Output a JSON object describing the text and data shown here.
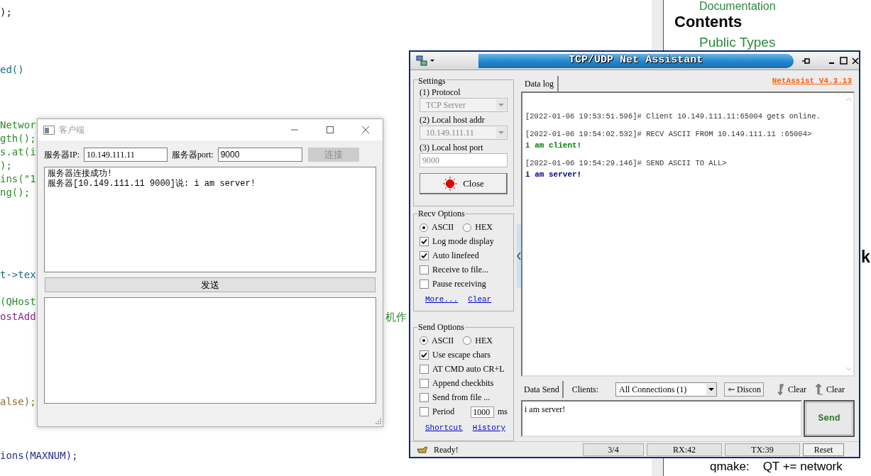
{
  "code_editor": {
    "lines": [
      {
        "text": ");",
        "kind": "plain"
      },
      {
        "text": "ed()",
        "kind": "method"
      },
      {
        "text": "Networ",
        "kind": "type"
      },
      {
        "text": "gth();",
        "kind": "type"
      },
      {
        "text": "s.at(i",
        "kind": "type"
      },
      {
        "text": ");",
        "kind": "type"
      },
      {
        "text": "ins(\"1",
        "kind": "type"
      },
      {
        "text": "ng();",
        "kind": "type"
      },
      {
        "text": "t->tex",
        "kind": "method"
      },
      {
        "text": "(QHost",
        "kind": "type"
      },
      {
        "text": "ostAdd",
        "kind": "member"
      },
      {
        "text": "alse);",
        "kind": "keyword"
      },
      {
        "text": "ions(MAXNUM);",
        "kind": "macro"
      }
    ],
    "comment_fragment": "机作"
  },
  "docs": {
    "link_top": "Documentation",
    "heading": "Contents",
    "link": "Public Types",
    "heading_fragment": "k",
    "note": "qmake:    QT += network"
  },
  "client_window": {
    "title": "客户端",
    "ip_label": "服务器IP:",
    "ip_value": "10.149.111.11",
    "port_label": "服务器port:",
    "port_value": "9000",
    "connect_button": {
      "label": "连接",
      "disabled": true
    },
    "log_lines": [
      "服务器连接成功!",
      "服务器[10.149.111.11 9000]说: i am server!"
    ],
    "send_button": "发送"
  },
  "net_assist": {
    "title": "TCP/UDP Net Assistant",
    "settings": {
      "title": "Settings",
      "disabled": true,
      "fields": [
        {
          "label": "(1) Protocol",
          "value": "TCP Server",
          "kind": "dropdown"
        },
        {
          "label": "(2) Local host addr",
          "value": "10.149.111.11",
          "kind": "dropdown"
        },
        {
          "label": "(3) Local host port",
          "value": "9000",
          "kind": "input"
        }
      ],
      "close_button": "Close"
    },
    "recv_options": {
      "title": "Recv Options",
      "modes": [
        {
          "label": "ASCII",
          "selected": true
        },
        {
          "label": "HEX",
          "selected": false
        }
      ],
      "checks": [
        {
          "label": "Log mode display",
          "checked": true
        },
        {
          "label": "Auto linefeed",
          "checked": true
        },
        {
          "label": "Receive to file...",
          "checked": false
        },
        {
          "label": "Pause receiving",
          "checked": false
        }
      ],
      "links": [
        "More...",
        "Clear"
      ]
    },
    "send_options": {
      "title": "Send Options",
      "modes": [
        {
          "label": "ASCII",
          "selected": true
        },
        {
          "label": "HEX",
          "selected": false
        }
      ],
      "checks": [
        {
          "label": "Use escape chars",
          "checked": true,
          "kind": "plain"
        },
        {
          "label": "AT CMD auto CR+L",
          "checked": false,
          "kind": "plain"
        },
        {
          "label": "Append checkbits",
          "checked": false,
          "kind": "plain"
        },
        {
          "label": "Send from file ...",
          "checked": false,
          "kind": "plain"
        },
        {
          "label": "Period",
          "checked": false,
          "kind": "period",
          "value": "1000",
          "unit": "ms"
        }
      ],
      "links": [
        "Shortcut",
        "History"
      ]
    },
    "status": "Ready!",
    "log_tab": "Data log",
    "version": "NetAssist V4.3.13",
    "log": [
      {
        "header": "[2022-01-06 19:53:51.596]# Client 10.149.111.11:65004 gets online."
      },
      {
        "header": "[2022-01-06 19:54:02.532]# RECV ASCII FROM 10.149.111.11 :65004>",
        "message": "i am client!",
        "color": "#008000"
      },
      {
        "header": "[2022-01-06 19:54:29.146]# SEND ASCII TO ALL>",
        "message": "i am server!",
        "color": "#000080"
      }
    ],
    "send_tab": "Data Send",
    "clients_label": "Clients:",
    "clients_value": "All Connections (1)",
    "disconnect_button": "Discon",
    "clear_buttons": [
      "Clear",
      "Clear"
    ],
    "send_text": "i am server!",
    "send_button": "Send",
    "counters": [
      "3/4",
      "RX:42",
      "TX:39"
    ],
    "reset_button": "Reset"
  }
}
